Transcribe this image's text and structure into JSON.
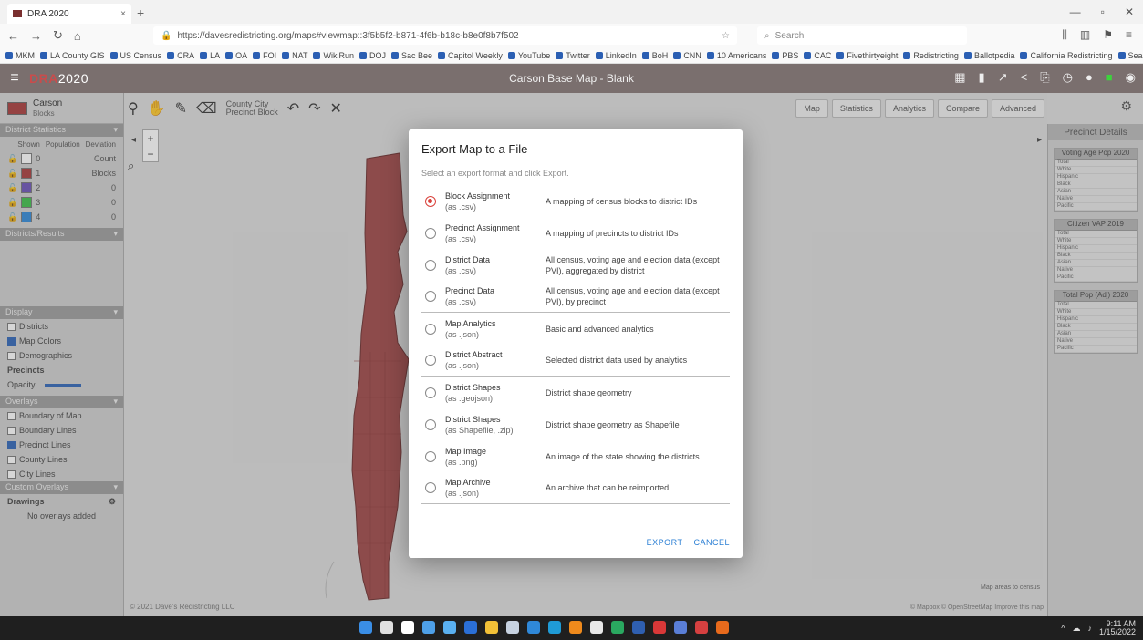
{
  "browser": {
    "tab_title": "DRA 2020",
    "url": "https://davesredistricting.org/maps#viewmap::3f5b5f2-b871-4f6b-b18c-b8e0f8b7f502",
    "search_placeholder": "Search",
    "bookmarks": [
      "MKM",
      "LA County GIS",
      "US Census",
      "CRA",
      "LA",
      "OA",
      "FOI",
      "NAT",
      "WikiRun",
      "DOJ",
      "Sac Bee",
      "Capitol Weekly",
      "YouTube",
      "Twitter",
      "LinkedIn",
      "BoH",
      "CNN",
      "10 Americans",
      "PBS",
      "CAC",
      "Fivethirtyeight",
      "Redistricting",
      "Ballotpedia",
      "California Redistricting",
      "Search at Initial"
    ]
  },
  "app": {
    "logo_main": "DRA",
    "logo_year": "2020",
    "map_title": "Carson Base Map - Blank",
    "colors": {
      "header": "#7a6f6e",
      "district_fill": "#9e4646",
      "accent": "#2b7fd4",
      "radio_selected": "#d9403a"
    }
  },
  "left_panel": {
    "map_name": "Carson",
    "map_sub": "Blocks",
    "districts_header": "District Statistics",
    "district_columns": [
      "Shown",
      "Population",
      "Deviation"
    ],
    "districts": [
      {
        "id": "0",
        "color": "#ffffff",
        "pop": "Count"
      },
      {
        "id": "1",
        "color": "#a83a3a",
        "pop": "Blocks"
      },
      {
        "id": "2",
        "color": "#6d52b8",
        "pop": "0"
      },
      {
        "id": "3",
        "color": "#3dbf4a",
        "pop": "0"
      },
      {
        "id": "4",
        "color": "#2f88d8",
        "pop": "0"
      }
    ],
    "region_header": "Districts/Results",
    "display_header": "Display",
    "display_opts": [
      "Districts",
      "Map Colors",
      "Demographics"
    ],
    "precincts_label": "Precincts",
    "opacity_label": "Opacity",
    "overlays_header": "Overlays",
    "overlay_opts": [
      "Boundary of Map",
      "Boundary Lines",
      "Precinct Lines",
      "County Lines",
      "City Lines"
    ],
    "custom_overlays_header": "Custom Overlays",
    "drawings_label": "Drawings",
    "no_overlays": "No overlays added"
  },
  "right_panel": {
    "title": "Precinct Details",
    "boxes": [
      "Voting Age Pop 2020",
      "Citizen VAP 2019",
      "Total Pop (Adj) 2020"
    ],
    "rows": [
      "Total",
      "White",
      "Hispanic",
      "Black",
      "Asian",
      "Native",
      "Pacific"
    ]
  },
  "dialog": {
    "title": "Export Map to a File",
    "subtitle": "Select an export format and click Export.",
    "options": [
      {
        "name": "Block Assignment",
        "ext": "(as .csv)",
        "desc": "A mapping of census blocks to district IDs",
        "selected": true
      },
      {
        "name": "Precinct Assignment",
        "ext": "(as .csv)",
        "desc": "A mapping of precincts to district IDs",
        "selected": false
      },
      {
        "name": "District Data",
        "ext": "(as .csv)",
        "desc": "All census, voting age and election data (except PVI), aggregated by district",
        "selected": false
      },
      {
        "name": "Precinct Data",
        "ext": "(as .csv)",
        "desc": "All census, voting age and election data (except PVI), by precinct",
        "selected": false
      },
      {
        "name": "Map Analytics",
        "ext": "(as .json)",
        "desc": "Basic and advanced analytics",
        "selected": false
      },
      {
        "name": "District Abstract",
        "ext": "(as .json)",
        "desc": "Selected district data used by analytics",
        "selected": false
      },
      {
        "name": "District Shapes",
        "ext": "(as .geojson)",
        "desc": "District shape geometry",
        "selected": false
      },
      {
        "name": "District Shapes",
        "ext": "(as Shapefile, .zip)",
        "desc": "District shape geometry as Shapefile",
        "selected": false
      },
      {
        "name": "Map Image",
        "ext": "(as .png)",
        "desc": "An image of the state showing the districts",
        "selected": false
      },
      {
        "name": "Map Archive",
        "ext": "(as .json)",
        "desc": "An archive that can be reimported",
        "selected": false
      }
    ],
    "export_label": "EXPORT",
    "cancel_label": "CANCEL"
  },
  "map": {
    "attribution": "© 2021 Dave's Redistricting LLC",
    "attribution_right": "© Mapbox © OpenStreetMap  Improve this map",
    "map_link": "Map areas to census"
  },
  "taskbar": {
    "time": "9:11 AM",
    "date": "1/15/2022"
  }
}
